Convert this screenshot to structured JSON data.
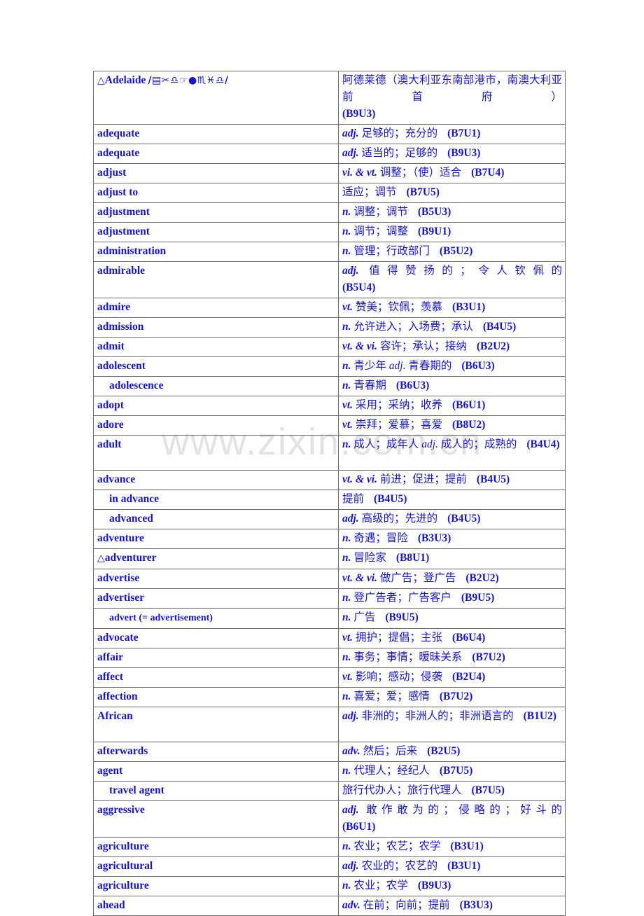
{
  "watermark": {
    "text": "www.zixin.com.cn"
  },
  "colors": {
    "text": "#1515CC",
    "border": "#6B6B6B",
    "watermark": "#E2E2E2",
    "background": "#FFFFFF"
  },
  "table": {
    "columns": [
      "term",
      "definition"
    ],
    "rows": [
      {
        "marker": "△",
        "term": "Adelaide",
        "phonetic": "/▤✂︎♎☞●♏♓♎/",
        "indent": false,
        "pos": "",
        "meaning": "阿德莱德（澳大利亚东南部港市，南澳大利亚前首府）",
        "ref": "(B9U3)",
        "lines": 2,
        "justify": true
      },
      {
        "marker": "",
        "term": "adequate",
        "phonetic": "",
        "indent": false,
        "pos": "adj.",
        "meaning": "足够的；充分的",
        "ref": "(B7U1)",
        "lines": 1,
        "justify": false
      },
      {
        "marker": "",
        "term": "adequate",
        "phonetic": "",
        "indent": false,
        "pos": "adj.",
        "meaning": "适当的；足够的",
        "ref": "(B9U3)",
        "lines": 1,
        "justify": false
      },
      {
        "marker": "",
        "term": "adjust",
        "phonetic": "",
        "indent": false,
        "pos": "vi. & vt.",
        "meaning": "调整；（使）适合",
        "ref": "(B7U4)",
        "lines": 1,
        "justify": false
      },
      {
        "marker": "",
        "term": "adjust to",
        "phonetic": "",
        "indent": false,
        "pos": "",
        "meaning": "适应；调节",
        "ref": "(B7U5)",
        "lines": 1,
        "justify": false
      },
      {
        "marker": "",
        "term": "adjustment",
        "phonetic": "",
        "indent": false,
        "pos": "n.",
        "meaning": "调整；调节",
        "ref": "(B5U3)",
        "lines": 1,
        "justify": false
      },
      {
        "marker": "",
        "term": "adjustment",
        "phonetic": "",
        "indent": false,
        "pos": "n.",
        "meaning": "调节；调整",
        "ref": "(B9U1)",
        "lines": 1,
        "justify": false
      },
      {
        "marker": "",
        "term": "administration",
        "phonetic": "",
        "indent": false,
        "pos": "n.",
        "meaning": "管理；行政部门",
        "ref": "(B5U2)",
        "lines": 1,
        "justify": false
      },
      {
        "marker": "",
        "term": "admirable",
        "phonetic": "",
        "indent": false,
        "pos": "adj.",
        "meaning": "值得赞扬的；令人钦佩的",
        "ref": "(B5U4)",
        "lines": 2,
        "justify": true
      },
      {
        "marker": "",
        "term": "admire",
        "phonetic": "",
        "indent": false,
        "pos": "vt.",
        "meaning": "赞美；钦佩；羡慕",
        "ref": "(B3U1)",
        "lines": 1,
        "justify": false
      },
      {
        "marker": "",
        "term": "admission",
        "phonetic": "",
        "indent": false,
        "pos": "n.",
        "meaning": "允许进入；入场费；承认",
        "ref": "(B4U5)",
        "lines": 1,
        "justify": false
      },
      {
        "marker": "",
        "term": "admit",
        "phonetic": "",
        "indent": false,
        "pos": "vt. & vi.",
        "meaning": "容许；承认；接纳",
        "ref": "(B2U2)",
        "lines": 1,
        "justify": false
      },
      {
        "marker": "",
        "term": "adolescent",
        "phonetic": "",
        "indent": false,
        "pos": "n.",
        "meaning": "青少年 <i>adj.</i> 青春期的",
        "ref": "(B6U3)",
        "lines": 1,
        "justify": false
      },
      {
        "marker": "",
        "term": "adolescence",
        "phonetic": "",
        "indent": true,
        "pos": "n.",
        "meaning": "青春期",
        "ref": "(B6U3)",
        "lines": 1,
        "justify": false
      },
      {
        "marker": "",
        "term": "adopt",
        "phonetic": "",
        "indent": false,
        "pos": "vt.",
        "meaning": "采用；采纳；收养",
        "ref": "(B6U1)",
        "lines": 1,
        "justify": false
      },
      {
        "marker": "",
        "term": "adore",
        "phonetic": "",
        "indent": false,
        "pos": "vt.",
        "meaning": "崇拜；爱慕；喜爱",
        "ref": "(B8U2)",
        "lines": 1,
        "justify": false
      },
      {
        "marker": "",
        "term": "adult",
        "phonetic": "",
        "indent": false,
        "pos": "n.",
        "meaning": "成人；成年人 <i>adj.</i> 成人的；成熟的",
        "ref": "(B4U4)",
        "lines": 2,
        "justify": false
      },
      {
        "marker": "",
        "term": "advance",
        "phonetic": "",
        "indent": false,
        "pos": "vt. & vi.",
        "meaning": "前进；促进；提前",
        "ref": "(B4U5)",
        "lines": 1,
        "justify": false
      },
      {
        "marker": "",
        "term": "in advance",
        "phonetic": "",
        "indent": true,
        "pos": "",
        "meaning": "提前",
        "ref": "(B4U5)",
        "lines": 1,
        "justify": false
      },
      {
        "marker": "",
        "term": "advanced",
        "phonetic": "",
        "indent": true,
        "pos": "adj.",
        "meaning": "高级的；先进的",
        "ref": "(B4U5)",
        "lines": 1,
        "justify": false
      },
      {
        "marker": "",
        "term": "adventure",
        "phonetic": "",
        "indent": false,
        "pos": "n.",
        "meaning": "奇遇；冒险",
        "ref": "(B3U3)",
        "lines": 1,
        "justify": false
      },
      {
        "marker": "△",
        "term": "adventurer",
        "phonetic": "",
        "indent": false,
        "pos": "n.",
        "meaning": "冒险家",
        "ref": "(B8U1)",
        "lines": 1,
        "justify": false
      },
      {
        "marker": "",
        "term": "advertise",
        "phonetic": "",
        "indent": false,
        "pos": "vt. & vi.",
        "meaning": "做广告；登广告",
        "ref": "(B2U2)",
        "lines": 1,
        "justify": false
      },
      {
        "marker": "",
        "term": "advertiser",
        "phonetic": "",
        "indent": false,
        "pos": "n.",
        "meaning": "登广告者；广告客户",
        "ref": "(B9U5)",
        "lines": 1,
        "justify": false
      },
      {
        "marker": "",
        "term": "advert (= advertisement)",
        "phonetic": "",
        "indent": true,
        "pos": "n.",
        "meaning": "广告",
        "ref": "(B9U5)",
        "lines": 1,
        "justify": false
      },
      {
        "marker": "",
        "term": "advocate",
        "phonetic": "",
        "indent": false,
        "pos": "vt.",
        "meaning": "拥护；提倡；主张",
        "ref": "(B6U4)",
        "lines": 1,
        "justify": false
      },
      {
        "marker": "",
        "term": "affair",
        "phonetic": "",
        "indent": false,
        "pos": "n.",
        "meaning": "事务；事情；暧昧关系",
        "ref": "(B7U2)",
        "lines": 1,
        "justify": false
      },
      {
        "marker": "",
        "term": "affect",
        "phonetic": "",
        "indent": false,
        "pos": "vt.",
        "meaning": "影响；感动；侵袭",
        "ref": "(B2U4)",
        "lines": 1,
        "justify": false
      },
      {
        "marker": "",
        "term": "affection",
        "phonetic": "",
        "indent": false,
        "pos": "n.",
        "meaning": "喜爱；爱；感情",
        "ref": "(B7U2)",
        "lines": 1,
        "justify": false
      },
      {
        "marker": "",
        "term": "African",
        "phonetic": "",
        "indent": false,
        "pos": "adj.",
        "meaning": "非洲的；非洲人的；非洲语言的",
        "ref": "(B1U2)",
        "lines": 2,
        "justify": false
      },
      {
        "marker": "",
        "term": "afterwards",
        "phonetic": "",
        "indent": false,
        "pos": "adv.",
        "meaning": "然后；后来",
        "ref": "(B2U5)",
        "lines": 1,
        "justify": false
      },
      {
        "marker": "",
        "term": "agent",
        "phonetic": "",
        "indent": false,
        "pos": "n.",
        "meaning": "代理人；经纪人",
        "ref": "(B7U5)",
        "lines": 1,
        "justify": false
      },
      {
        "marker": "",
        "term": "travel agent",
        "phonetic": "",
        "indent": true,
        "pos": "",
        "meaning": "旅行代办人；旅行代理人",
        "ref": "(B7U5)",
        "lines": 1,
        "justify": false
      },
      {
        "marker": "",
        "term": "aggressive",
        "phonetic": "",
        "indent": false,
        "pos": "adj.",
        "meaning": "敢作敢为的；侵略的；好斗的",
        "ref": "(B6U1)",
        "lines": 2,
        "justify": true
      },
      {
        "marker": "",
        "term": "agriculture",
        "phonetic": "",
        "indent": false,
        "pos": "n.",
        "meaning": "农业；农艺；农学",
        "ref": "(B3U1)",
        "lines": 1,
        "justify": false
      },
      {
        "marker": "",
        "term": "agricultural",
        "phonetic": "",
        "indent": false,
        "pos": "adj.",
        "meaning": "农业的；农艺的",
        "ref": "(B3U1)",
        "lines": 1,
        "justify": false
      },
      {
        "marker": "",
        "term": "agriculture",
        "phonetic": "",
        "indent": false,
        "pos": "n.",
        "meaning": "农业；农学",
        "ref": "(B9U3)",
        "lines": 1,
        "justify": false
      },
      {
        "marker": "",
        "term": "ahead",
        "phonetic": "",
        "indent": false,
        "pos": "adv.",
        "meaning": "在前；向前；提前",
        "ref": "(B3U3)",
        "lines": 1,
        "justify": false
      }
    ]
  }
}
